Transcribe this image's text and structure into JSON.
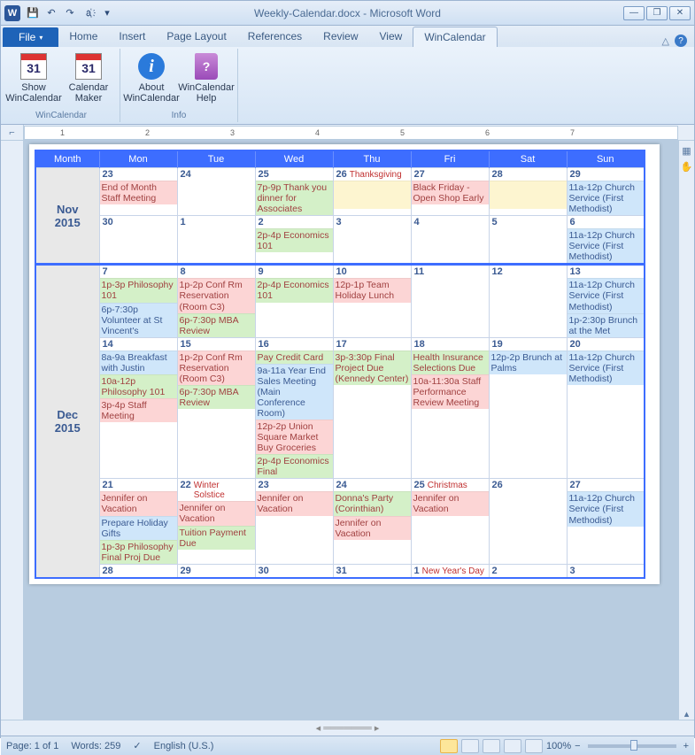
{
  "title": "Weekly-Calendar.docx - Microsoft Word",
  "qat": {
    "save": "💾",
    "undo": "↶",
    "redo": "↷",
    "lang": "a҉"
  },
  "tabs": {
    "file": "File",
    "items": [
      "Home",
      "Insert",
      "Page Layout",
      "References",
      "Review",
      "View",
      "WinCalendar"
    ],
    "active": "WinCalendar"
  },
  "ribbon": {
    "groups": [
      {
        "label": "WinCalendar",
        "buttons": [
          {
            "id": "show-wincal",
            "label": "Show WinCalendar",
            "icon": "cal31"
          },
          {
            "id": "cal-maker",
            "label": "Calendar Maker",
            "icon": "cal31"
          }
        ]
      },
      {
        "label": "Info",
        "buttons": [
          {
            "id": "about",
            "label": "About WinCalendar",
            "icon": "info"
          },
          {
            "id": "help",
            "label": "WinCalendar Help",
            "icon": "book"
          }
        ]
      }
    ]
  },
  "ruler_marks": [
    "1",
    "2",
    "3",
    "4",
    "5",
    "6",
    "7"
  ],
  "calendar": {
    "headers": [
      "Month",
      "Mon",
      "Tue",
      "Wed",
      "Thu",
      "Fri",
      "Sat",
      "Sun"
    ],
    "sections": [
      {
        "label1": "Nov",
        "label2": "2015",
        "rowspan": 2,
        "rows": [
          {
            "sep": false,
            "days": [
              {
                "num": "23",
                "events": [
                  {
                    "t": "End of Month Staff Meeting",
                    "c": "pink"
                  }
                ]
              },
              {
                "num": "24",
                "events": []
              },
              {
                "num": "25",
                "events": [
                  {
                    "t": "7p-9p Thank you dinner for Associates",
                    "c": "green"
                  }
                ]
              },
              {
                "num": "26",
                "holiday": "Thanksgiving",
                "events": [
                  {
                    "t": "",
                    "c": "yellow"
                  }
                ]
              },
              {
                "num": "27",
                "events": [
                  {
                    "t": "Black Friday - Open Shop Early",
                    "c": "pink"
                  }
                ]
              },
              {
                "num": "28",
                "events": [
                  {
                    "t": "",
                    "c": "yellow"
                  }
                ]
              },
              {
                "num": "29",
                "events": [
                  {
                    "t": "11a-12p Church Service (First Methodist)",
                    "c": "blue"
                  }
                ]
              }
            ]
          },
          {
            "sep": false,
            "days": [
              {
                "num": "30",
                "events": []
              },
              {
                "num": "1",
                "events": []
              },
              {
                "num": "2",
                "events": [
                  {
                    "t": "2p-4p Economics 101",
                    "c": "green"
                  }
                ]
              },
              {
                "num": "3",
                "events": []
              },
              {
                "num": "4",
                "events": []
              },
              {
                "num": "5",
                "events": []
              },
              {
                "num": "6",
                "events": [
                  {
                    "t": "11a-12p Church Service (First Methodist)",
                    "c": "blue"
                  }
                ]
              }
            ]
          }
        ]
      },
      {
        "label1": "Dec",
        "label2": "2015",
        "rowspan": 4,
        "rows": [
          {
            "sep": true,
            "days": [
              {
                "num": "7",
                "events": [
                  {
                    "t": "1p-3p Philosophy 101",
                    "c": "green"
                  },
                  {
                    "t": "6p-7:30p Volunteer at St Vincent's",
                    "c": "blue"
                  }
                ]
              },
              {
                "num": "8",
                "events": [
                  {
                    "t": "1p-2p Conf Rm Reservation (Room C3)",
                    "c": "pink"
                  },
                  {
                    "t": "6p-7:30p MBA Review",
                    "c": "green"
                  }
                ]
              },
              {
                "num": "9",
                "events": [
                  {
                    "t": "2p-4p Economics 101",
                    "c": "green"
                  }
                ]
              },
              {
                "num": "10",
                "events": [
                  {
                    "t": "12p-1p Team Holiday Lunch",
                    "c": "pink"
                  }
                ]
              },
              {
                "num": "11",
                "events": []
              },
              {
                "num": "12",
                "events": []
              },
              {
                "num": "13",
                "events": [
                  {
                    "t": "11a-12p Church Service (First Methodist)",
                    "c": "blue"
                  },
                  {
                    "t": "1p-2:30p Brunch at the Met",
                    "c": "blue"
                  }
                ]
              }
            ]
          },
          {
            "sep": false,
            "days": [
              {
                "num": "14",
                "events": [
                  {
                    "t": "8a-9a Breakfast with Justin",
                    "c": "blue"
                  },
                  {
                    "t": "10a-12p Philosophy 101",
                    "c": "green"
                  },
                  {
                    "t": "3p-4p Staff Meeting",
                    "c": "pink"
                  }
                ]
              },
              {
                "num": "15",
                "events": [
                  {
                    "t": "1p-2p Conf Rm Reservation (Room C3)",
                    "c": "pink"
                  },
                  {
                    "t": "6p-7:30p MBA Review",
                    "c": "green"
                  }
                ]
              },
              {
                "num": "16",
                "events": [
                  {
                    "t": "Pay Credit Card",
                    "c": "green"
                  },
                  {
                    "t": "9a-11a Year End Sales Meeting (Main Conference Room)",
                    "c": "blue"
                  },
                  {
                    "t": "12p-2p Union Square Market Buy Groceries",
                    "c": "pink"
                  },
                  {
                    "t": "2p-4p Economics Final",
                    "c": "green"
                  }
                ]
              },
              {
                "num": "17",
                "events": [
                  {
                    "t": "3p-3:30p Final Project Due (Kennedy Center)",
                    "c": "green"
                  }
                ]
              },
              {
                "num": "18",
                "events": [
                  {
                    "t": "Health Insurance Selections Due",
                    "c": "green"
                  },
                  {
                    "t": "10a-11:30a Staff Performance Review Meeting",
                    "c": "pink"
                  }
                ]
              },
              {
                "num": "19",
                "events": [
                  {
                    "t": "12p-2p Brunch at Palms",
                    "c": "blue"
                  }
                ]
              },
              {
                "num": "20",
                "events": [
                  {
                    "t": "11a-12p Church Service (First Methodist)",
                    "c": "blue"
                  }
                ]
              }
            ]
          },
          {
            "sep": false,
            "days": [
              {
                "num": "21",
                "events": [
                  {
                    "t": "Jennifer on Vacation",
                    "c": "pink"
                  },
                  {
                    "t": "Prepare Holiday Gifts",
                    "c": "blue"
                  },
                  {
                    "t": "1p-3p Philosophy Final Proj Due",
                    "c": "green"
                  }
                ]
              },
              {
                "num": "22",
                "holiday": "Winter Solstice",
                "events": [
                  {
                    "t": "Jennifer on Vacation",
                    "c": "pink"
                  },
                  {
                    "t": "Tuition Payment Due",
                    "c": "green"
                  }
                ]
              },
              {
                "num": "23",
                "events": [
                  {
                    "t": "Jennifer on Vacation",
                    "c": "pink"
                  }
                ]
              },
              {
                "num": "24",
                "events": [
                  {
                    "t": "Donna's Party (Corinthian)",
                    "c": "green"
                  },
                  {
                    "t": "Jennifer on Vacation",
                    "c": "pink"
                  }
                ]
              },
              {
                "num": "25",
                "holiday": "Christmas",
                "events": [
                  {
                    "t": "Jennifer on Vacation",
                    "c": "pink"
                  }
                ]
              },
              {
                "num": "26",
                "events": []
              },
              {
                "num": "27",
                "events": [
                  {
                    "t": "11a-12p Church Service (First Methodist)",
                    "c": "blue"
                  }
                ]
              }
            ]
          },
          {
            "sep": false,
            "days": [
              {
                "num": "28",
                "events": []
              },
              {
                "num": "29",
                "events": []
              },
              {
                "num": "30",
                "events": []
              },
              {
                "num": "31",
                "events": []
              },
              {
                "num": "1",
                "holiday": "New Year's Day",
                "events": []
              },
              {
                "num": "2",
                "events": []
              },
              {
                "num": "3",
                "events": []
              }
            ]
          }
        ]
      }
    ]
  },
  "status": {
    "page": "Page: 1 of 1",
    "words": "Words: 259",
    "lang": "English (U.S.)",
    "zoom": "100%"
  }
}
